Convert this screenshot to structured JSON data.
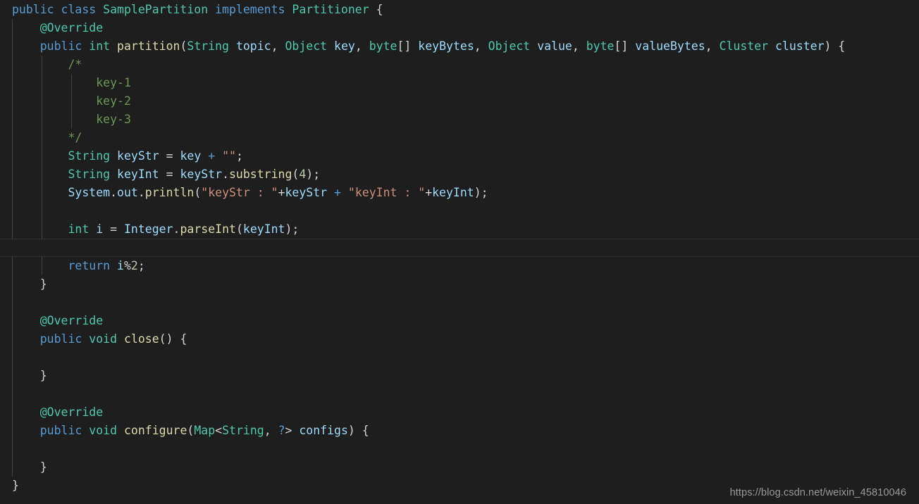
{
  "editor": {
    "language": "java",
    "file_title": "SamplePartition.java",
    "theme": "dark-plus",
    "background_color": "#1e1e1e",
    "default_text_color": "#d4d4d4",
    "current_line_index": 13,
    "colors": {
      "keyword": "#569cd6",
      "type": "#4ec9b0",
      "function": "#dcdcaa",
      "variable": "#9cdcfe",
      "annotation": "#4ec9b0",
      "string": "#ce9178",
      "comment": "#6a9955",
      "number": "#b5cea8",
      "punctuation": "#d4d4d4",
      "indent_guide": "#404040",
      "current_line_background": "#1f1f1f",
      "current_line_border": "#2f2f2f",
      "watermark": "#9a9a9a"
    },
    "indent_guides_x": [
      17,
      59,
      101
    ],
    "lines": [
      [
        {
          "t": "public",
          "c": "kw"
        },
        {
          "t": " ",
          "c": "pun"
        },
        {
          "t": "class",
          "c": "kw"
        },
        {
          "t": " ",
          "c": "pun"
        },
        {
          "t": "SamplePartition",
          "c": "typ"
        },
        {
          "t": " ",
          "c": "pun"
        },
        {
          "t": "implements",
          "c": "kw"
        },
        {
          "t": " ",
          "c": "pun"
        },
        {
          "t": "Partitioner",
          "c": "typ"
        },
        {
          "t": " {",
          "c": "pun"
        }
      ],
      [
        {
          "t": "    ",
          "c": "pun"
        },
        {
          "t": "@Override",
          "c": "ann"
        }
      ],
      [
        {
          "t": "    ",
          "c": "pun"
        },
        {
          "t": "public",
          "c": "kw"
        },
        {
          "t": " ",
          "c": "pun"
        },
        {
          "t": "int",
          "c": "typ"
        },
        {
          "t": " ",
          "c": "pun"
        },
        {
          "t": "partition",
          "c": "fn"
        },
        {
          "t": "(",
          "c": "pun"
        },
        {
          "t": "String",
          "c": "typ"
        },
        {
          "t": " ",
          "c": "pun"
        },
        {
          "t": "topic",
          "c": "var"
        },
        {
          "t": ", ",
          "c": "pun"
        },
        {
          "t": "Object",
          "c": "typ"
        },
        {
          "t": " ",
          "c": "pun"
        },
        {
          "t": "key",
          "c": "var"
        },
        {
          "t": ", ",
          "c": "pun"
        },
        {
          "t": "byte",
          "c": "typ"
        },
        {
          "t": "[] ",
          "c": "pun"
        },
        {
          "t": "keyBytes",
          "c": "var"
        },
        {
          "t": ", ",
          "c": "pun"
        },
        {
          "t": "Object",
          "c": "typ"
        },
        {
          "t": " ",
          "c": "pun"
        },
        {
          "t": "value",
          "c": "var"
        },
        {
          "t": ", ",
          "c": "pun"
        },
        {
          "t": "byte",
          "c": "typ"
        },
        {
          "t": "[] ",
          "c": "pun"
        },
        {
          "t": "valueBytes",
          "c": "var"
        },
        {
          "t": ", ",
          "c": "pun"
        },
        {
          "t": "Cluster",
          "c": "typ"
        },
        {
          "t": " ",
          "c": "pun"
        },
        {
          "t": "cluster",
          "c": "var"
        },
        {
          "t": ") {",
          "c": "pun"
        }
      ],
      [
        {
          "t": "        ",
          "c": "pun"
        },
        {
          "t": "/*",
          "c": "cmt"
        }
      ],
      [
        {
          "t": "            ",
          "c": "pun"
        },
        {
          "t": "key-1",
          "c": "cmt"
        }
      ],
      [
        {
          "t": "            ",
          "c": "pun"
        },
        {
          "t": "key-2",
          "c": "cmt"
        }
      ],
      [
        {
          "t": "            ",
          "c": "pun"
        },
        {
          "t": "key-3",
          "c": "cmt"
        }
      ],
      [
        {
          "t": "        ",
          "c": "pun"
        },
        {
          "t": "*/",
          "c": "cmt"
        }
      ],
      [
        {
          "t": "        ",
          "c": "pun"
        },
        {
          "t": "String",
          "c": "typ"
        },
        {
          "t": " ",
          "c": "pun"
        },
        {
          "t": "keyStr",
          "c": "var"
        },
        {
          "t": " ",
          "c": "pun"
        },
        {
          "t": "=",
          "c": "pun"
        },
        {
          "t": " ",
          "c": "pun"
        },
        {
          "t": "key",
          "c": "var"
        },
        {
          "t": " ",
          "c": "pun"
        },
        {
          "t": "+",
          "c": "op"
        },
        {
          "t": " ",
          "c": "pun"
        },
        {
          "t": "\"\"",
          "c": "str"
        },
        {
          "t": ";",
          "c": "pun"
        }
      ],
      [
        {
          "t": "        ",
          "c": "pun"
        },
        {
          "t": "String",
          "c": "typ"
        },
        {
          "t": " ",
          "c": "pun"
        },
        {
          "t": "keyInt",
          "c": "var"
        },
        {
          "t": " ",
          "c": "pun"
        },
        {
          "t": "=",
          "c": "pun"
        },
        {
          "t": " ",
          "c": "pun"
        },
        {
          "t": "keyStr",
          "c": "var"
        },
        {
          "t": ".",
          "c": "pun"
        },
        {
          "t": "substring",
          "c": "fn"
        },
        {
          "t": "(",
          "c": "pun"
        },
        {
          "t": "4",
          "c": "num"
        },
        {
          "t": ");",
          "c": "pun"
        }
      ],
      [
        {
          "t": "        ",
          "c": "pun"
        },
        {
          "t": "System",
          "c": "var"
        },
        {
          "t": ".",
          "c": "pun"
        },
        {
          "t": "out",
          "c": "var"
        },
        {
          "t": ".",
          "c": "pun"
        },
        {
          "t": "println",
          "c": "fn"
        },
        {
          "t": "(",
          "c": "pun"
        },
        {
          "t": "\"keyStr : \"",
          "c": "str"
        },
        {
          "t": "+",
          "c": "pun"
        },
        {
          "t": "keyStr",
          "c": "var"
        },
        {
          "t": " ",
          "c": "pun"
        },
        {
          "t": "+",
          "c": "op"
        },
        {
          "t": " ",
          "c": "pun"
        },
        {
          "t": "\"keyInt : \"",
          "c": "str"
        },
        {
          "t": "+",
          "c": "pun"
        },
        {
          "t": "keyInt",
          "c": "var"
        },
        {
          "t": ");",
          "c": "pun"
        }
      ],
      [],
      [
        {
          "t": "        ",
          "c": "pun"
        },
        {
          "t": "int",
          "c": "typ"
        },
        {
          "t": " ",
          "c": "pun"
        },
        {
          "t": "i",
          "c": "var"
        },
        {
          "t": " ",
          "c": "pun"
        },
        {
          "t": "=",
          "c": "pun"
        },
        {
          "t": " ",
          "c": "pun"
        },
        {
          "t": "Integer",
          "c": "var"
        },
        {
          "t": ".",
          "c": "pun"
        },
        {
          "t": "parseInt",
          "c": "fn"
        },
        {
          "t": "(",
          "c": "pun"
        },
        {
          "t": "keyInt",
          "c": "var"
        },
        {
          "t": ");",
          "c": "pun"
        }
      ],
      [],
      [
        {
          "t": "        ",
          "c": "pun"
        },
        {
          "t": "return",
          "c": "kw"
        },
        {
          "t": " ",
          "c": "pun"
        },
        {
          "t": "i",
          "c": "var"
        },
        {
          "t": "%",
          "c": "pun"
        },
        {
          "t": "2",
          "c": "num"
        },
        {
          "t": ";",
          "c": "pun"
        }
      ],
      [
        {
          "t": "    }",
          "c": "pun"
        }
      ],
      [],
      [
        {
          "t": "    ",
          "c": "pun"
        },
        {
          "t": "@Override",
          "c": "ann"
        }
      ],
      [
        {
          "t": "    ",
          "c": "pun"
        },
        {
          "t": "public",
          "c": "kw"
        },
        {
          "t": " ",
          "c": "pun"
        },
        {
          "t": "void",
          "c": "typ"
        },
        {
          "t": " ",
          "c": "pun"
        },
        {
          "t": "close",
          "c": "fn"
        },
        {
          "t": "() {",
          "c": "pun"
        }
      ],
      [],
      [
        {
          "t": "    }",
          "c": "pun"
        }
      ],
      [],
      [
        {
          "t": "    ",
          "c": "pun"
        },
        {
          "t": "@Override",
          "c": "ann"
        }
      ],
      [
        {
          "t": "    ",
          "c": "pun"
        },
        {
          "t": "public",
          "c": "kw"
        },
        {
          "t": " ",
          "c": "pun"
        },
        {
          "t": "void",
          "c": "typ"
        },
        {
          "t": " ",
          "c": "pun"
        },
        {
          "t": "configure",
          "c": "fn"
        },
        {
          "t": "(",
          "c": "pun"
        },
        {
          "t": "Map",
          "c": "typ"
        },
        {
          "t": "<",
          "c": "pun"
        },
        {
          "t": "String",
          "c": "typ"
        },
        {
          "t": ", ",
          "c": "pun"
        },
        {
          "t": "?",
          "c": "kw"
        },
        {
          "t": "> ",
          "c": "pun"
        },
        {
          "t": "configs",
          "c": "var"
        },
        {
          "t": ") {",
          "c": "pun"
        }
      ],
      [],
      [
        {
          "t": "    }",
          "c": "pun"
        }
      ],
      [
        {
          "t": "}",
          "c": "pun"
        }
      ]
    ]
  },
  "watermark": {
    "text": "https://blog.csdn.net/weixin_45810046"
  }
}
